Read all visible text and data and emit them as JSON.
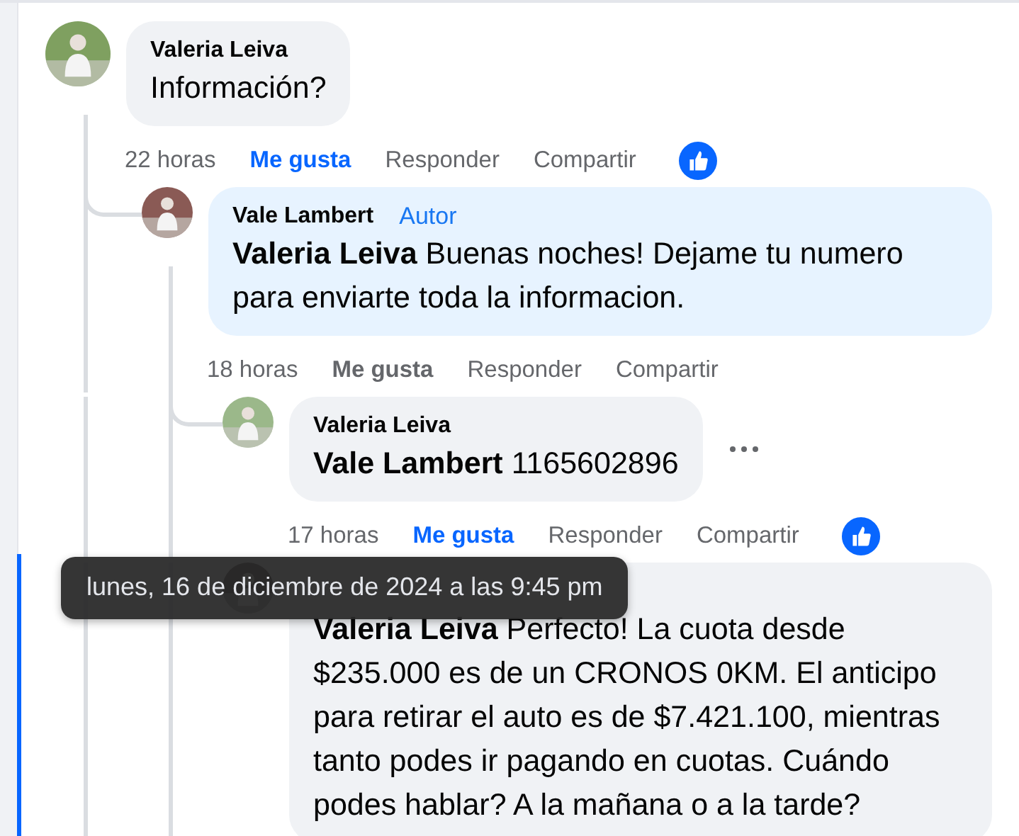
{
  "comments": [
    {
      "kind": "reply",
      "author": "Valeria Leiva",
      "text": "Información?",
      "time": "22 horas",
      "like_label": "Me gusta",
      "liked": true,
      "reply_label": "Responder",
      "share_label": "Compartir",
      "reaction": true,
      "highlighted": false,
      "children": [
        {
          "kind": "author",
          "author": "Vale Lambert",
          "badge": "Autor",
          "text": "**Valeria Leiva** Buenas noches! Dejame tu numero para enviarte toda la informacion.",
          "time": "18 horas",
          "like_label": "Me gusta",
          "liked": false,
          "reply_label": "Responder",
          "share_label": "Compartir",
          "reaction": false,
          "highlighted": false,
          "children": [
            {
              "kind": "reply",
              "author": "Valeria Leiva",
              "text": "**Vale Lambert** 1165602896",
              "time": "17 horas",
              "like_label": "Me gusta",
              "liked": true,
              "reply_label": "Responder",
              "share_label": "Compartir",
              "reaction": true,
              "more_menu": true,
              "highlighted": false
            },
            {
              "kind": "reply",
              "text": "**Valeria Leiva** Perfecto! La cuota desde $235.000 es de un CRONOS 0KM. El anticipo para retirar el auto es de $7.421.100, mientras tanto podes ir pagando en cuotas. Cuándo podes hablar? A la mañana o a la tarde?",
              "highlighted": true
            }
          ]
        }
      ]
    }
  ],
  "tooltip": {
    "text": "lunes, 16 de diciembre de 2024 a las 9:45 pm"
  }
}
